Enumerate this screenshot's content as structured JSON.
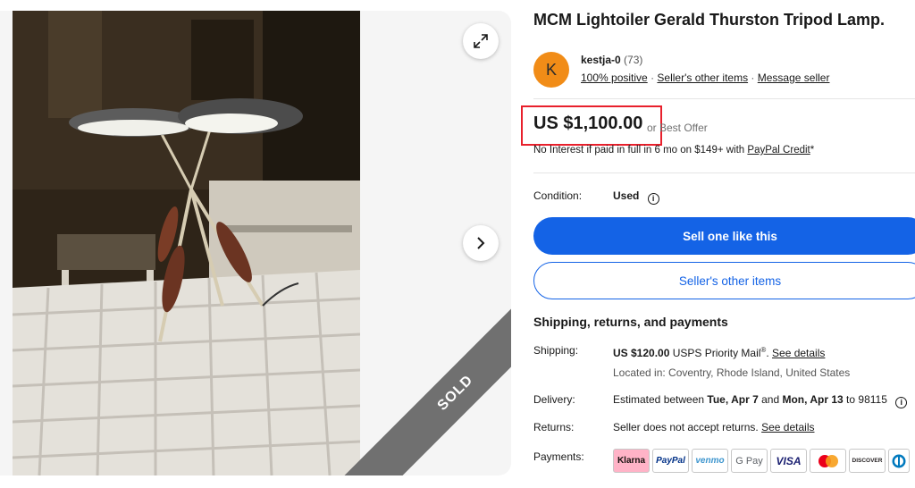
{
  "gallery": {
    "sold_label": "SOLD",
    "expand_icon": "expand-icon",
    "next_icon": "chevron-right-icon"
  },
  "listing": {
    "title": "MCM Lightoiler Gerald Thurston Tripod Lamp."
  },
  "seller": {
    "avatar_letter": "K",
    "name": "kestja-0",
    "feedback_count": "(73)",
    "positive": "100% positive",
    "sep": "·",
    "other_items_link": "Seller's other items",
    "message_link": "Message seller"
  },
  "price": {
    "amount": "US $1,100.00",
    "best_offer": "or Best Offer",
    "financing_text": "No Interest if paid in full in 6 mo on $149+ with",
    "financing_link": "PayPal Credit",
    "financing_suffix": "*"
  },
  "condition": {
    "label": "Condition:",
    "value": "Used"
  },
  "buttons": {
    "sell_one": "Sell one like this",
    "seller_other_items": "Seller's other items"
  },
  "shipping_section": {
    "heading": "Shipping, returns, and payments",
    "shipping_label": "Shipping:",
    "shipping_cost": "US $120.00",
    "shipping_service": "USPS Priority Mail",
    "shipping_reg": "®",
    "see_details": "See details",
    "located": "Located in: Coventry, Rhode Island, United States",
    "delivery_label": "Delivery:",
    "delivery_prefix": "Estimated between",
    "delivery_start": "Tue, Apr 7",
    "delivery_and": "and",
    "delivery_end": "Mon, Apr 13",
    "delivery_zip": "to 98115",
    "returns_label": "Returns:",
    "returns_text": "Seller does not accept returns.",
    "returns_link": "See details",
    "payments_label": "Payments:",
    "payment_methods": [
      "Klarna",
      "PayPal",
      "venmo",
      "G Pay",
      "VISA",
      "mastercard",
      "DISCOVER",
      "diners"
    ]
  },
  "colors": {
    "primary": "#1463e6",
    "avatar": "#f18c17",
    "highlight": "#e8202c",
    "sold_banner": "#707070"
  }
}
